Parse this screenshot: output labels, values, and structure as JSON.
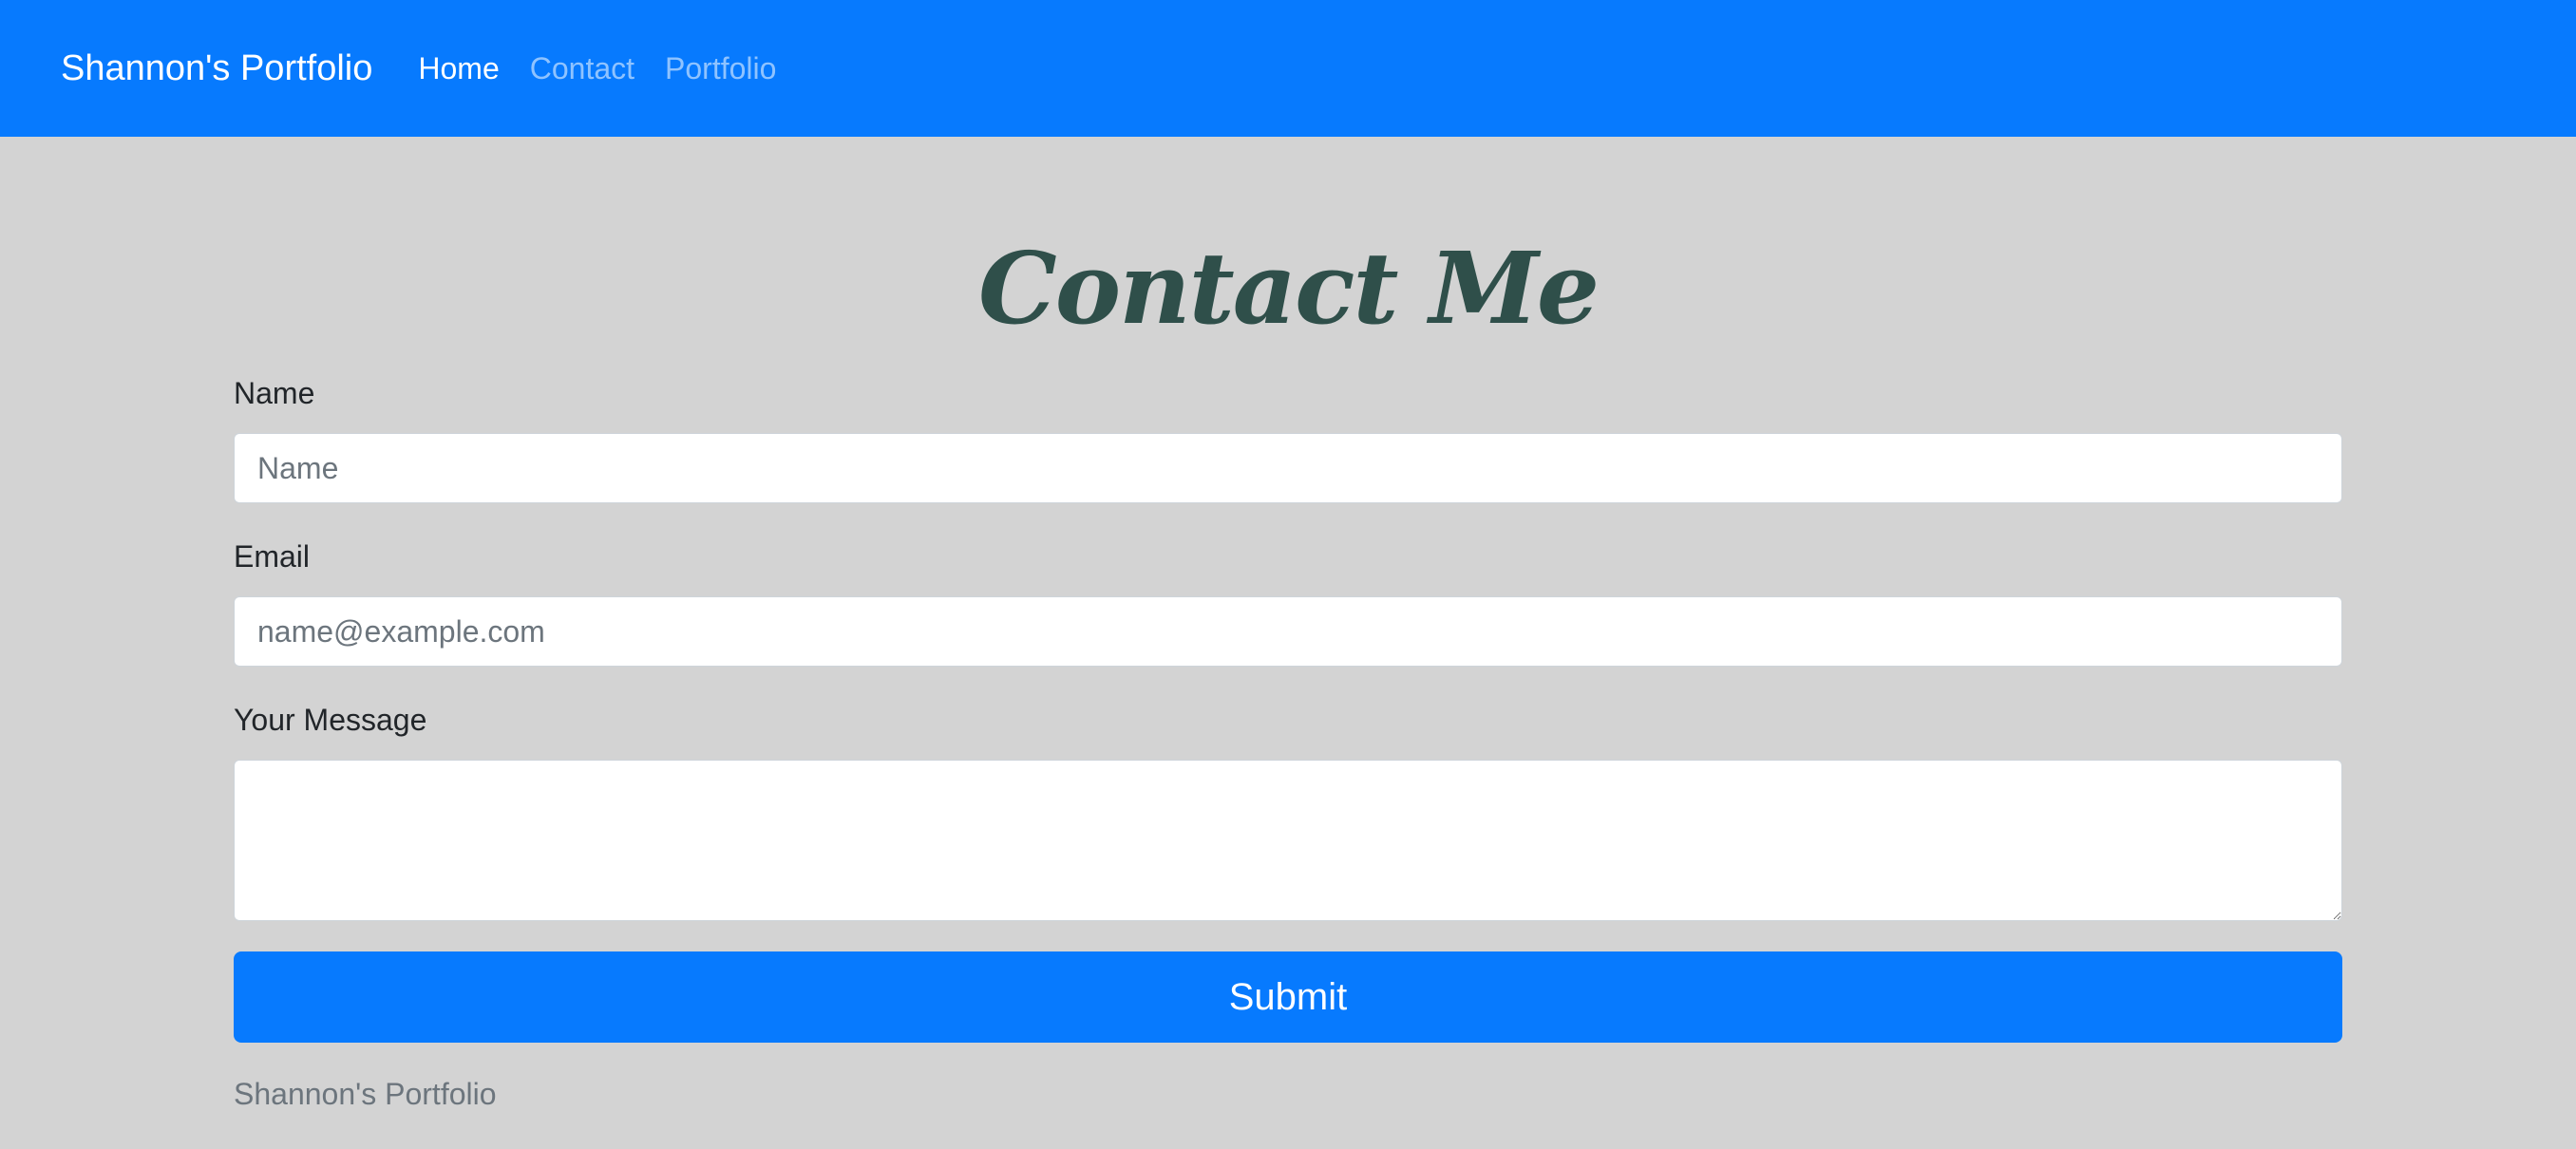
{
  "navbar": {
    "brand": "Shannon's Portfolio",
    "links": [
      {
        "label": "Home"
      },
      {
        "label": "Contact"
      },
      {
        "label": "Portfolio"
      }
    ]
  },
  "form": {
    "title": "Contact Me",
    "name_label": "Name",
    "name_placeholder": "Name",
    "name_value": "",
    "email_label": "Email",
    "email_placeholder": "name@example.com",
    "email_value": "",
    "message_label": "Your Message",
    "message_value": "",
    "submit_label": "Submit"
  },
  "footer": {
    "text": "Shannon's Portfolio"
  },
  "colors": {
    "primary": "#077afe",
    "background": "#d3d3d3",
    "heading": "#2f4f4a"
  }
}
